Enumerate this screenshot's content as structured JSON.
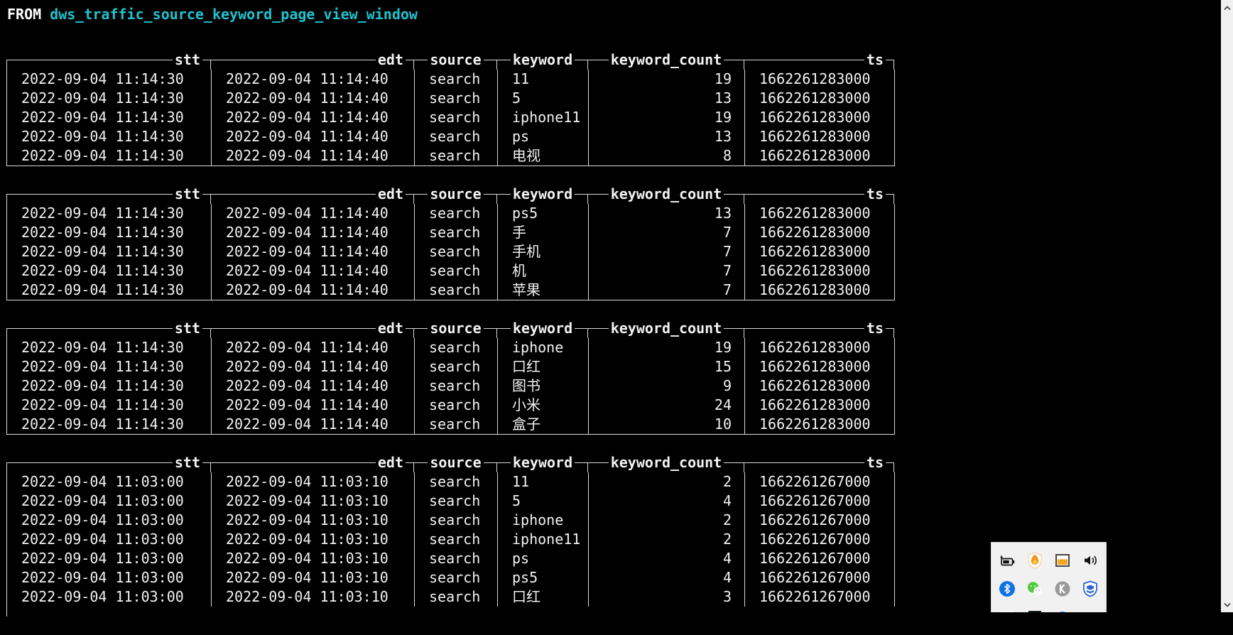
{
  "colors": {
    "background": "#000000",
    "text": "#f2f2f2",
    "line": "#d9d9d9",
    "cyan": "#1fc3d0",
    "tray_bg": "#f1f1f1"
  },
  "query": {
    "keyword": "FROM",
    "table_name": "dws_traffic_source_keyword_page_view_window"
  },
  "columns": [
    "stt",
    "edt",
    "source",
    "keyword",
    "keyword_count",
    "ts"
  ],
  "tables": [
    {
      "rows": [
        {
          "stt": "2022-09-04 11:14:30",
          "edt": "2022-09-04 11:14:40",
          "source": "search",
          "keyword": "11",
          "keyword_count": "19",
          "ts": "1662261283000"
        },
        {
          "stt": "2022-09-04 11:14:30",
          "edt": "2022-09-04 11:14:40",
          "source": "search",
          "keyword": "5",
          "keyword_count": "13",
          "ts": "1662261283000"
        },
        {
          "stt": "2022-09-04 11:14:30",
          "edt": "2022-09-04 11:14:40",
          "source": "search",
          "keyword": "iphone11",
          "keyword_count": "19",
          "ts": "1662261283000"
        },
        {
          "stt": "2022-09-04 11:14:30",
          "edt": "2022-09-04 11:14:40",
          "source": "search",
          "keyword": "ps",
          "keyword_count": "13",
          "ts": "1662261283000"
        },
        {
          "stt": "2022-09-04 11:14:30",
          "edt": "2022-09-04 11:14:40",
          "source": "search",
          "keyword": "电视",
          "keyword_count": "8",
          "ts": "1662261283000"
        }
      ]
    },
    {
      "rows": [
        {
          "stt": "2022-09-04 11:14:30",
          "edt": "2022-09-04 11:14:40",
          "source": "search",
          "keyword": "ps5",
          "keyword_count": "13",
          "ts": "1662261283000"
        },
        {
          "stt": "2022-09-04 11:14:30",
          "edt": "2022-09-04 11:14:40",
          "source": "search",
          "keyword": "手",
          "keyword_count": "7",
          "ts": "1662261283000"
        },
        {
          "stt": "2022-09-04 11:14:30",
          "edt": "2022-09-04 11:14:40",
          "source": "search",
          "keyword": "手机",
          "keyword_count": "7",
          "ts": "1662261283000"
        },
        {
          "stt": "2022-09-04 11:14:30",
          "edt": "2022-09-04 11:14:40",
          "source": "search",
          "keyword": "机",
          "keyword_count": "7",
          "ts": "1662261283000"
        },
        {
          "stt": "2022-09-04 11:14:30",
          "edt": "2022-09-04 11:14:40",
          "source": "search",
          "keyword": "苹果",
          "keyword_count": "7",
          "ts": "1662261283000"
        }
      ]
    },
    {
      "rows": [
        {
          "stt": "2022-09-04 11:14:30",
          "edt": "2022-09-04 11:14:40",
          "source": "search",
          "keyword": "iphone",
          "keyword_count": "19",
          "ts": "1662261283000"
        },
        {
          "stt": "2022-09-04 11:14:30",
          "edt": "2022-09-04 11:14:40",
          "source": "search",
          "keyword": "口红",
          "keyword_count": "15",
          "ts": "1662261283000"
        },
        {
          "stt": "2022-09-04 11:14:30",
          "edt": "2022-09-04 11:14:40",
          "source": "search",
          "keyword": "图书",
          "keyword_count": "9",
          "ts": "1662261283000"
        },
        {
          "stt": "2022-09-04 11:14:30",
          "edt": "2022-09-04 11:14:40",
          "source": "search",
          "keyword": "小米",
          "keyword_count": "24",
          "ts": "1662261283000"
        },
        {
          "stt": "2022-09-04 11:14:30",
          "edt": "2022-09-04 11:14:40",
          "source": "search",
          "keyword": "盒子",
          "keyword_count": "10",
          "ts": "1662261283000"
        }
      ]
    },
    {
      "rows": [
        {
          "stt": "2022-09-04 11:03:00",
          "edt": "2022-09-04 11:03:10",
          "source": "search",
          "keyword": "11",
          "keyword_count": "2",
          "ts": "1662261267000"
        },
        {
          "stt": "2022-09-04 11:03:00",
          "edt": "2022-09-04 11:03:10",
          "source": "search",
          "keyword": "5",
          "keyword_count": "4",
          "ts": "1662261267000"
        },
        {
          "stt": "2022-09-04 11:03:00",
          "edt": "2022-09-04 11:03:10",
          "source": "search",
          "keyword": "iphone",
          "keyword_count": "2",
          "ts": "1662261267000"
        },
        {
          "stt": "2022-09-04 11:03:00",
          "edt": "2022-09-04 11:03:10",
          "source": "search",
          "keyword": "iphone11",
          "keyword_count": "2",
          "ts": "1662261267000"
        },
        {
          "stt": "2022-09-04 11:03:00",
          "edt": "2022-09-04 11:03:10",
          "source": "search",
          "keyword": "ps",
          "keyword_count": "4",
          "ts": "1662261267000"
        },
        {
          "stt": "2022-09-04 11:03:00",
          "edt": "2022-09-04 11:03:10",
          "source": "search",
          "keyword": "ps5",
          "keyword_count": "4",
          "ts": "1662261267000"
        },
        {
          "stt": "2022-09-04 11:03:00",
          "edt": "2022-09-04 11:03:10",
          "source": "search",
          "keyword": "口红",
          "keyword_count": "3",
          "ts": "1662261267000"
        }
      ]
    }
  ],
  "scrollbar": {
    "up_icon": "chevron-up",
    "down_icon": "chevron-down"
  },
  "tray": {
    "icon_rows": [
      [
        "battery-power",
        "flame-shield",
        "app-window",
        "volume"
      ],
      [
        "bluetooth",
        "wechat",
        "letter-k",
        "blue-shield"
      ],
      [
        "window-outline",
        "green-app",
        "blue-dot",
        "partial"
      ]
    ]
  }
}
